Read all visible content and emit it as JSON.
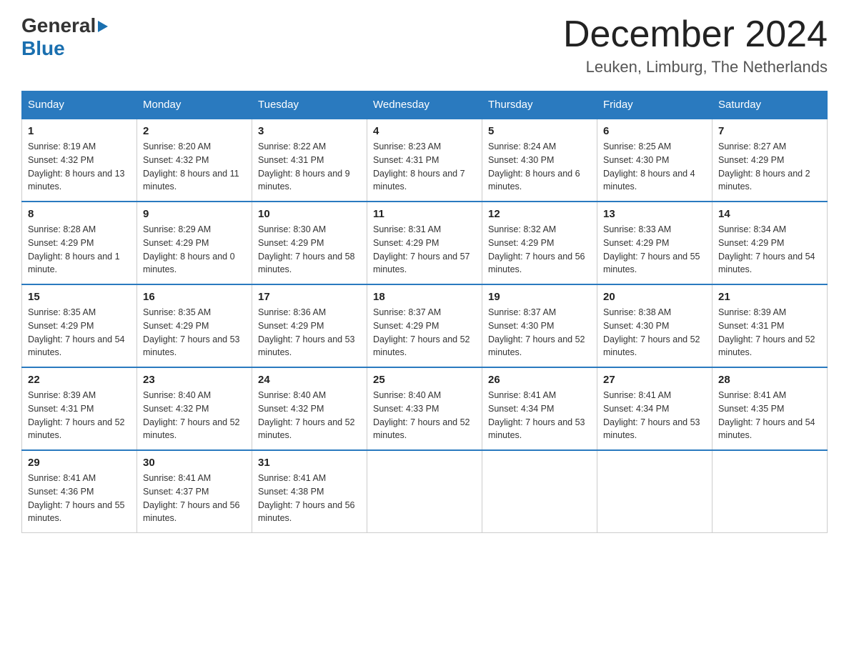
{
  "header": {
    "logo_general": "General",
    "logo_blue": "Blue",
    "month_title": "December 2024",
    "subtitle": "Leuken, Limburg, The Netherlands"
  },
  "days_of_week": [
    "Sunday",
    "Monday",
    "Tuesday",
    "Wednesday",
    "Thursday",
    "Friday",
    "Saturday"
  ],
  "weeks": [
    [
      {
        "day": "1",
        "sunrise": "8:19 AM",
        "sunset": "4:32 PM",
        "daylight": "8 hours and 13 minutes."
      },
      {
        "day": "2",
        "sunrise": "8:20 AM",
        "sunset": "4:32 PM",
        "daylight": "8 hours and 11 minutes."
      },
      {
        "day": "3",
        "sunrise": "8:22 AM",
        "sunset": "4:31 PM",
        "daylight": "8 hours and 9 minutes."
      },
      {
        "day": "4",
        "sunrise": "8:23 AM",
        "sunset": "4:31 PM",
        "daylight": "8 hours and 7 minutes."
      },
      {
        "day": "5",
        "sunrise": "8:24 AM",
        "sunset": "4:30 PM",
        "daylight": "8 hours and 6 minutes."
      },
      {
        "day": "6",
        "sunrise": "8:25 AM",
        "sunset": "4:30 PM",
        "daylight": "8 hours and 4 minutes."
      },
      {
        "day": "7",
        "sunrise": "8:27 AM",
        "sunset": "4:29 PM",
        "daylight": "8 hours and 2 minutes."
      }
    ],
    [
      {
        "day": "8",
        "sunrise": "8:28 AM",
        "sunset": "4:29 PM",
        "daylight": "8 hours and 1 minute."
      },
      {
        "day": "9",
        "sunrise": "8:29 AM",
        "sunset": "4:29 PM",
        "daylight": "8 hours and 0 minutes."
      },
      {
        "day": "10",
        "sunrise": "8:30 AM",
        "sunset": "4:29 PM",
        "daylight": "7 hours and 58 minutes."
      },
      {
        "day": "11",
        "sunrise": "8:31 AM",
        "sunset": "4:29 PM",
        "daylight": "7 hours and 57 minutes."
      },
      {
        "day": "12",
        "sunrise": "8:32 AM",
        "sunset": "4:29 PM",
        "daylight": "7 hours and 56 minutes."
      },
      {
        "day": "13",
        "sunrise": "8:33 AM",
        "sunset": "4:29 PM",
        "daylight": "7 hours and 55 minutes."
      },
      {
        "day": "14",
        "sunrise": "8:34 AM",
        "sunset": "4:29 PM",
        "daylight": "7 hours and 54 minutes."
      }
    ],
    [
      {
        "day": "15",
        "sunrise": "8:35 AM",
        "sunset": "4:29 PM",
        "daylight": "7 hours and 54 minutes."
      },
      {
        "day": "16",
        "sunrise": "8:35 AM",
        "sunset": "4:29 PM",
        "daylight": "7 hours and 53 minutes."
      },
      {
        "day": "17",
        "sunrise": "8:36 AM",
        "sunset": "4:29 PM",
        "daylight": "7 hours and 53 minutes."
      },
      {
        "day": "18",
        "sunrise": "8:37 AM",
        "sunset": "4:29 PM",
        "daylight": "7 hours and 52 minutes."
      },
      {
        "day": "19",
        "sunrise": "8:37 AM",
        "sunset": "4:30 PM",
        "daylight": "7 hours and 52 minutes."
      },
      {
        "day": "20",
        "sunrise": "8:38 AM",
        "sunset": "4:30 PM",
        "daylight": "7 hours and 52 minutes."
      },
      {
        "day": "21",
        "sunrise": "8:39 AM",
        "sunset": "4:31 PM",
        "daylight": "7 hours and 52 minutes."
      }
    ],
    [
      {
        "day": "22",
        "sunrise": "8:39 AM",
        "sunset": "4:31 PM",
        "daylight": "7 hours and 52 minutes."
      },
      {
        "day": "23",
        "sunrise": "8:40 AM",
        "sunset": "4:32 PM",
        "daylight": "7 hours and 52 minutes."
      },
      {
        "day": "24",
        "sunrise": "8:40 AM",
        "sunset": "4:32 PM",
        "daylight": "7 hours and 52 minutes."
      },
      {
        "day": "25",
        "sunrise": "8:40 AM",
        "sunset": "4:33 PM",
        "daylight": "7 hours and 52 minutes."
      },
      {
        "day": "26",
        "sunrise": "8:41 AM",
        "sunset": "4:34 PM",
        "daylight": "7 hours and 53 minutes."
      },
      {
        "day": "27",
        "sunrise": "8:41 AM",
        "sunset": "4:34 PM",
        "daylight": "7 hours and 53 minutes."
      },
      {
        "day": "28",
        "sunrise": "8:41 AM",
        "sunset": "4:35 PM",
        "daylight": "7 hours and 54 minutes."
      }
    ],
    [
      {
        "day": "29",
        "sunrise": "8:41 AM",
        "sunset": "4:36 PM",
        "daylight": "7 hours and 55 minutes."
      },
      {
        "day": "30",
        "sunrise": "8:41 AM",
        "sunset": "4:37 PM",
        "daylight": "7 hours and 56 minutes."
      },
      {
        "day": "31",
        "sunrise": "8:41 AM",
        "sunset": "4:38 PM",
        "daylight": "7 hours and 56 minutes."
      },
      null,
      null,
      null,
      null
    ]
  ],
  "labels": {
    "sunrise_prefix": "Sunrise: ",
    "sunset_prefix": "Sunset: ",
    "daylight_prefix": "Daylight: "
  }
}
